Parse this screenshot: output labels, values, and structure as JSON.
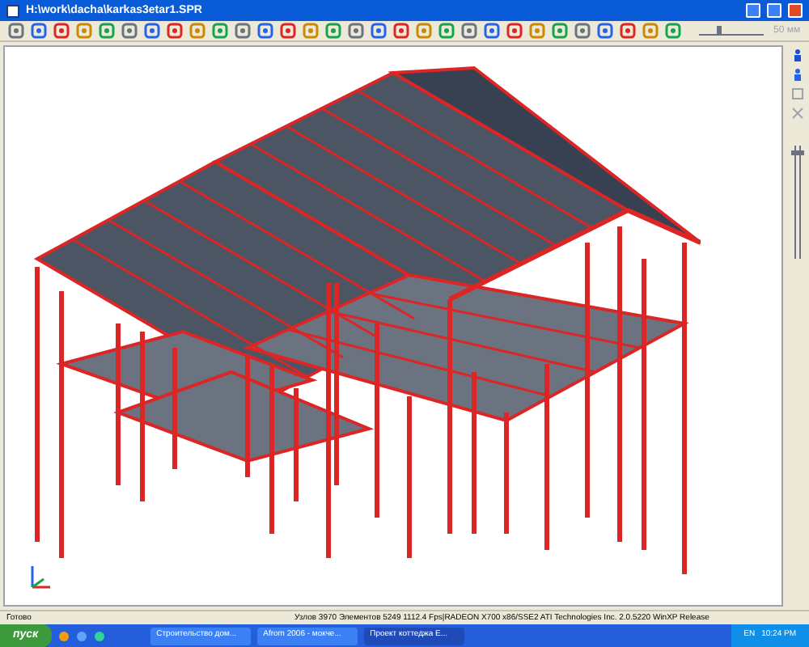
{
  "window": {
    "title": "H:\\work\\dacha\\karkas3etar1.SPR"
  },
  "toolbar": {
    "scale_slider": {
      "level": 0.3
    },
    "zoom_readout": "50 мм"
  },
  "side_slider": {
    "level": 0.95
  },
  "status_bar": {
    "state": "Готово",
    "info": "Узлов 3970  Элементов 5249  1112.4 Fps|RADEON X700 x86/SSE2 ATI Technologies Inc.  2.0.5220 WinXP Release"
  },
  "taskbar": {
    "start": "пуск",
    "tasks": [
      {
        "label": "Строительство дом...",
        "selected": false
      },
      {
        "label": "Afrom 2006 - мокче...",
        "selected": false
      },
      {
        "label": "Проект коттеджа E...",
        "selected": true
      }
    ],
    "language": "EN",
    "clock": "10:24 PM"
  }
}
